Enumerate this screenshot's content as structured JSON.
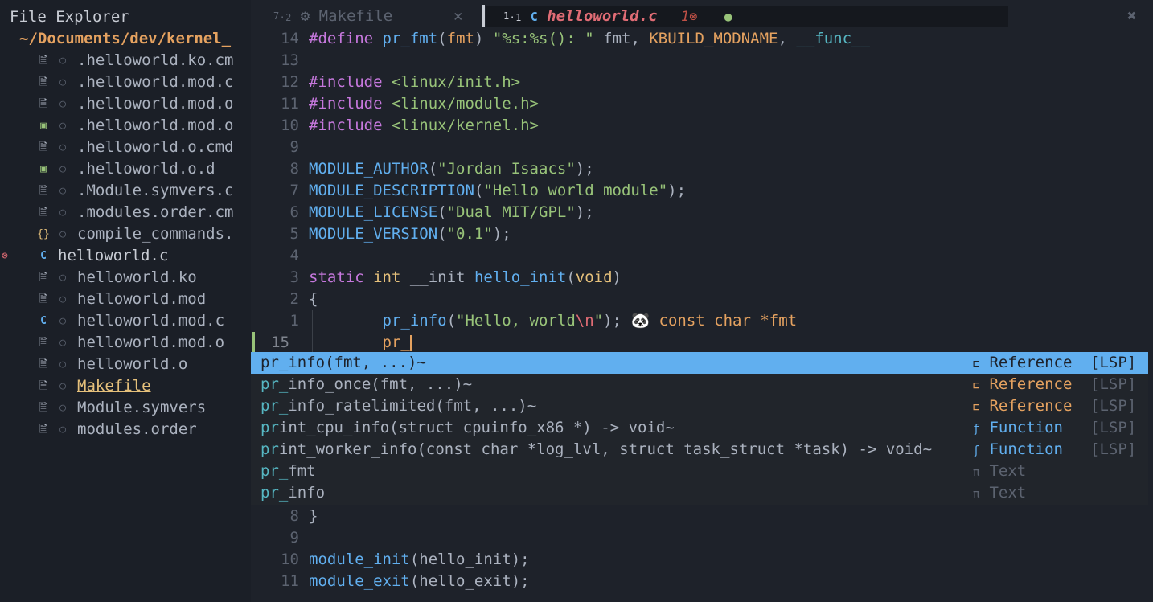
{
  "sidebar": {
    "title": "File Explorer",
    "root": "~/Documents/dev/kernel_",
    "items": [
      {
        "name": ".helloworld.ko.cm",
        "icon": "file-icon",
        "git": "○"
      },
      {
        "name": ".helloworld.mod.c",
        "icon": "file-icon",
        "git": "○"
      },
      {
        "name": ".helloworld.mod.o",
        "icon": "file-icon",
        "git": "○"
      },
      {
        "name": ".helloworld.mod.o",
        "icon": "terminal-icon",
        "git": "○"
      },
      {
        "name": ".helloworld.o.cmd",
        "icon": "file-icon",
        "git": "○"
      },
      {
        "name": ".helloworld.o.d",
        "icon": "terminal-icon",
        "git": "○"
      },
      {
        "name": ".Module.symvers.c",
        "icon": "file-icon",
        "git": "○"
      },
      {
        "name": ".modules.order.cm",
        "icon": "file-icon",
        "git": "○"
      },
      {
        "name": "compile_commands.",
        "icon": "json-icon",
        "git": "○"
      },
      {
        "name": "helloworld.c",
        "icon": "c-icon",
        "git": "",
        "error": "⊗"
      },
      {
        "name": "helloworld.ko",
        "icon": "file-icon",
        "git": "○"
      },
      {
        "name": "helloworld.mod",
        "icon": "file-icon",
        "git": "○"
      },
      {
        "name": "helloworld.mod.c",
        "icon": "c-icon",
        "git": "○"
      },
      {
        "name": "helloworld.mod.o",
        "icon": "file-icon",
        "git": "○"
      },
      {
        "name": "helloworld.o",
        "icon": "file-icon",
        "git": "○"
      },
      {
        "name": "Makefile",
        "icon": "file-icon",
        "git": "○"
      },
      {
        "name": "Module.symvers",
        "icon": "file-icon",
        "git": "○"
      },
      {
        "name": "modules.order",
        "icon": "file-icon",
        "git": "○"
      }
    ]
  },
  "tabs": {
    "tab1": {
      "index": "7",
      "sub": "2",
      "name": "Makefile",
      "close": "✕"
    },
    "tab2": {
      "index": "1",
      "sub": "1",
      "name": "helloworld.c",
      "errors": "1⊗",
      "modified": "●"
    },
    "close_all": "✖"
  },
  "editor": {
    "lines": [
      {
        "num": "14"
      },
      {
        "num": "13"
      },
      {
        "num": "12"
      },
      {
        "num": "11"
      },
      {
        "num": "10"
      },
      {
        "num": "9"
      },
      {
        "num": "8"
      },
      {
        "num": "7"
      },
      {
        "num": "6"
      },
      {
        "num": "5"
      },
      {
        "num": "4"
      },
      {
        "num": "3"
      },
      {
        "num": "2"
      },
      {
        "num": "1"
      },
      {
        "num": "15"
      },
      {
        "num": "8"
      },
      {
        "num": "9"
      },
      {
        "num": "10"
      },
      {
        "num": "11"
      }
    ],
    "t": {
      "define": "#define",
      "pr_fmt": "pr_fmt",
      "fmt": "fmt",
      "fmtstr": "\"%s:%s(): \"",
      "fmtrest": " fmt, ",
      "kbuild": "KBUILD_MODNAME",
      "comma": ", ",
      "func": "__func__",
      "include": "#include",
      "inc1": "<linux/init.h>",
      "inc2": "<linux/module.h>",
      "inc3": "<linux/kernel.h>",
      "ma": "MODULE_AUTHOR",
      "ma_s": "\"Jordan Isaacs\"",
      "md": "MODULE_DESCRIPTION",
      "md_s": "\"Hello world module\"",
      "ml": "MODULE_LICENSE",
      "ml_s": "\"Dual MIT/GPL\"",
      "mv": "MODULE_VERSION",
      "mv_s": "\"0.1\"",
      "static": "static",
      "int": "int",
      "init": " __init ",
      "hello_init": "hello_init",
      "void": "void",
      "lbrace": "{",
      "rbrace": "}",
      "pr_info": "pr_info",
      "hello_s": "\"Hello, world",
      "esc_n": "\\n",
      "quote": "\"",
      "hint": "🐼 const char *fmt",
      "typing": "pr_",
      "module_init": "module_init",
      "module_exit": "module_exit",
      "hello_exit": "hello_exit"
    }
  },
  "completion": {
    "items": [
      {
        "match": "pr_",
        "rest": "info(fmt, ...)~",
        "kind_icon": "⊏",
        "kind": "Reference",
        "source": "[LSP]",
        "color": "#e5a260"
      },
      {
        "match": "pr_",
        "rest": "info_once(fmt, ...)~",
        "kind_icon": "⊏",
        "kind": "Reference",
        "source": "[LSP]",
        "color": "#e5a260"
      },
      {
        "match": "pr_",
        "rest": "info_ratelimited(fmt, ...)~",
        "kind_icon": "⊏",
        "kind": "Reference",
        "source": "[LSP]",
        "color": "#e5a260"
      },
      {
        "match": "pr",
        "rest": "int_cpu_info(struct cpuinfo_x86 *) -> void~",
        "kind_icon": "ƒ",
        "kind": "Function",
        "source": "[LSP]",
        "color": "#61afef"
      },
      {
        "match": "pr",
        "rest": "int_worker_info(const char *log_lvl, struct task_struct *task) -> void~",
        "kind_icon": "ƒ",
        "kind": "Function",
        "source": "[LSP]",
        "color": "#61afef"
      },
      {
        "match": "pr_",
        "rest": "fmt",
        "kind_icon": "π",
        "kind": "Text",
        "source": "",
        "color": "#5c6370"
      },
      {
        "match": "pr_",
        "rest": "info",
        "kind_icon": "π",
        "kind": "Text",
        "source": "",
        "color": "#5c6370"
      }
    ]
  }
}
